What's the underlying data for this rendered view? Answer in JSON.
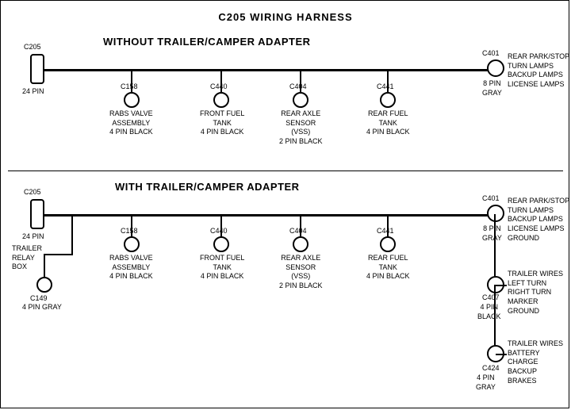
{
  "title": "C205 WIRING HARNESS",
  "section1": {
    "label": "WITHOUT  TRAILER/CAMPER  ADAPTER",
    "connectors": [
      {
        "id": "C205_top",
        "label": "C205",
        "sub": "24 PIN"
      },
      {
        "id": "C401_top",
        "label": "C401",
        "sub": "8 PIN\nGRAY"
      },
      {
        "id": "C158_top",
        "label": "C158",
        "sub": "RABS VALVE\nASSEMBLY\n4 PIN BLACK"
      },
      {
        "id": "C440_top",
        "label": "C440",
        "sub": "FRONT FUEL\nTANK\n4 PIN BLACK"
      },
      {
        "id": "C404_top",
        "label": "C404",
        "sub": "REAR AXLE\nSENSOR\n(VSS)\n2 PIN BLACK"
      },
      {
        "id": "C441_top",
        "label": "C441",
        "sub": "REAR FUEL\nTANK\n4 PIN BLACK"
      }
    ],
    "right_label": "REAR PARK/STOP\nTURN LAMPS\nBACKUP LAMPS\nLICENSE LAMPS"
  },
  "section2": {
    "label": "WITH  TRAILER/CAMPER  ADAPTER",
    "connectors": [
      {
        "id": "C205_bot",
        "label": "C205",
        "sub": "24 PIN"
      },
      {
        "id": "C401_bot",
        "label": "C401",
        "sub": "8 PIN\nGRAY"
      },
      {
        "id": "C158_bot",
        "label": "C158",
        "sub": "RABS VALVE\nASSEMBLY\n4 PIN BLACK"
      },
      {
        "id": "C440_bot",
        "label": "C440",
        "sub": "FRONT FUEL\nTANK\n4 PIN BLACK"
      },
      {
        "id": "C404_bot",
        "label": "C404",
        "sub": "REAR AXLE\nSENSOR\n(VSS)\n2 PIN BLACK"
      },
      {
        "id": "C441_bot",
        "label": "C441",
        "sub": "REAR FUEL\nTANK\n4 PIN BLACK"
      },
      {
        "id": "C149",
        "label": "C149",
        "sub": "4 PIN GRAY"
      },
      {
        "id": "C407",
        "label": "C407",
        "sub": "4 PIN\nBLACK"
      },
      {
        "id": "C424",
        "label": "C424",
        "sub": "4 PIN\nGRAY"
      }
    ],
    "right_labels": [
      "REAR PARK/STOP\nTURN LAMPS\nBACKUP LAMPS\nLICENSE LAMPS\nGROUND",
      "TRAILER WIRES\nLEFT TURN\nRIGHT TURN\nMARKER\nGROUND",
      "TRAILER WIRES\nBATTERY CHARGE\nBACKUP\nBRAKES"
    ],
    "trailer_relay": "TRAILER\nRELAY\nBOX"
  }
}
